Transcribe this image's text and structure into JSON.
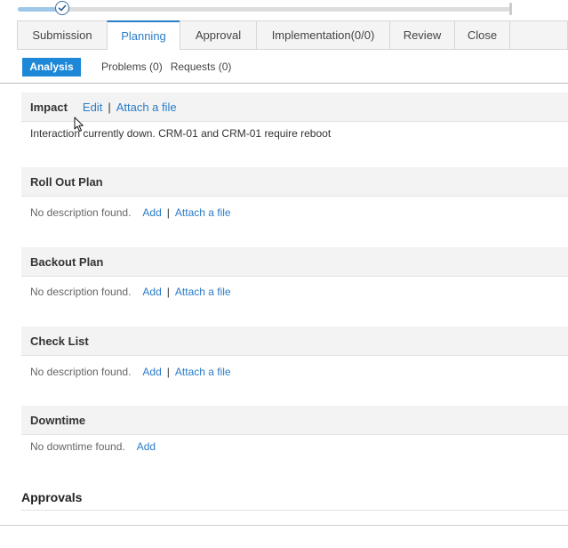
{
  "progress": {
    "value": 0.09
  },
  "tabs": [
    {
      "label": "Submission",
      "active": false
    },
    {
      "label": "Planning",
      "active": true
    },
    {
      "label": "Approval",
      "active": false
    },
    {
      "label": "Implementation(0/0)",
      "active": false
    },
    {
      "label": "Review",
      "active": false
    },
    {
      "label": "Close",
      "active": false
    }
  ],
  "subtabs": {
    "analysis": "Analysis",
    "problems": "Problems (0)",
    "requests": "Requests (0)"
  },
  "sections": {
    "impact": {
      "title": "Impact",
      "edit": "Edit",
      "separator": "|",
      "attach": "Attach a file",
      "text": "Interaction currently down. CRM-01 and CRM-01 require reboot"
    },
    "rollout": {
      "title": "Roll Out Plan",
      "empty": "No description found.",
      "add": "Add",
      "separator": "|",
      "attach": "Attach a file"
    },
    "backout": {
      "title": "Backout Plan",
      "empty": "No description found.",
      "add": "Add",
      "separator": "|",
      "attach": "Attach a file"
    },
    "checklist": {
      "title": "Check List",
      "empty": "No description found.",
      "add": "Add",
      "separator": "|",
      "attach": "Attach a file"
    },
    "downtime": {
      "title": "Downtime",
      "empty": "No downtime found.",
      "add": "Add"
    }
  },
  "approvals": {
    "title": "Approvals"
  },
  "colors": {
    "accent": "#2a7cc7",
    "active_subtab": "#1e88d8",
    "header_bg": "#f3f3f3"
  }
}
